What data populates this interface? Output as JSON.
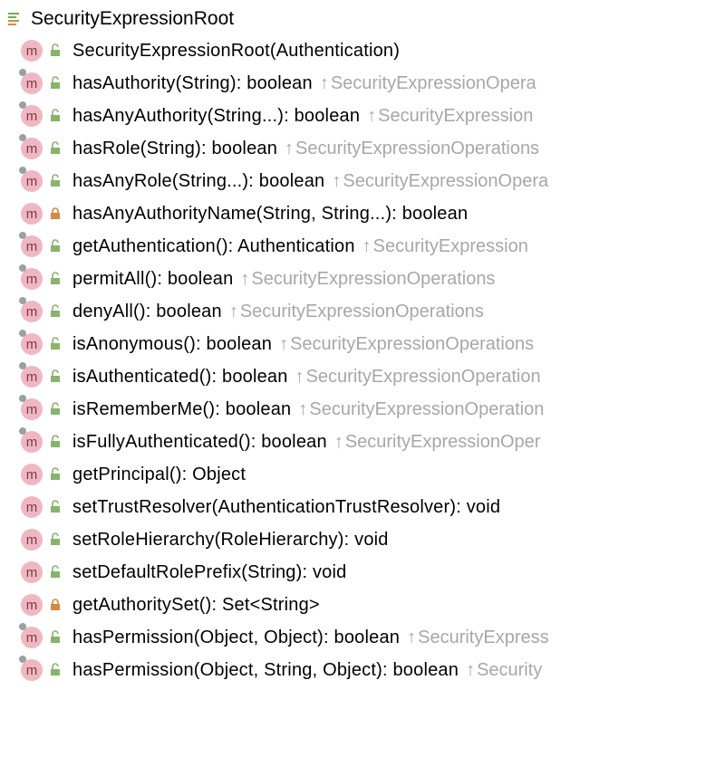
{
  "class_name": "SecurityExpressionRoot",
  "members": [
    {
      "signature": "SecurityExpressionRoot(Authentication)",
      "override": false,
      "visibility": "public",
      "inherited": ""
    },
    {
      "signature": "hasAuthority(String): boolean",
      "override": true,
      "visibility": "public",
      "inherited": "SecurityExpressionOpera"
    },
    {
      "signature": "hasAnyAuthority(String...): boolean",
      "override": true,
      "visibility": "public",
      "inherited": "SecurityExpression"
    },
    {
      "signature": "hasRole(String): boolean",
      "override": true,
      "visibility": "public",
      "inherited": "SecurityExpressionOperations"
    },
    {
      "signature": "hasAnyRole(String...): boolean",
      "override": true,
      "visibility": "public",
      "inherited": "SecurityExpressionOpera"
    },
    {
      "signature": "hasAnyAuthorityName(String, String...): boolean",
      "override": false,
      "visibility": "private",
      "inherited": ""
    },
    {
      "signature": "getAuthentication(): Authentication",
      "override": true,
      "visibility": "public",
      "inherited": "SecurityExpression"
    },
    {
      "signature": "permitAll(): boolean",
      "override": true,
      "visibility": "public",
      "inherited": "SecurityExpressionOperations"
    },
    {
      "signature": "denyAll(): boolean",
      "override": true,
      "visibility": "public",
      "inherited": "SecurityExpressionOperations"
    },
    {
      "signature": "isAnonymous(): boolean",
      "override": true,
      "visibility": "public",
      "inherited": "SecurityExpressionOperations"
    },
    {
      "signature": "isAuthenticated(): boolean",
      "override": true,
      "visibility": "public",
      "inherited": "SecurityExpressionOperation"
    },
    {
      "signature": "isRememberMe(): boolean",
      "override": true,
      "visibility": "public",
      "inherited": "SecurityExpressionOperation"
    },
    {
      "signature": "isFullyAuthenticated(): boolean",
      "override": true,
      "visibility": "public",
      "inherited": "SecurityExpressionOper"
    },
    {
      "signature": "getPrincipal(): Object",
      "override": false,
      "visibility": "public",
      "inherited": ""
    },
    {
      "signature": "setTrustResolver(AuthenticationTrustResolver): void",
      "override": false,
      "visibility": "public",
      "inherited": ""
    },
    {
      "signature": "setRoleHierarchy(RoleHierarchy): void",
      "override": false,
      "visibility": "public",
      "inherited": ""
    },
    {
      "signature": "setDefaultRolePrefix(String): void",
      "override": false,
      "visibility": "public",
      "inherited": ""
    },
    {
      "signature": "getAuthoritySet(): Set<String>",
      "override": false,
      "visibility": "private",
      "inherited": ""
    },
    {
      "signature": "hasPermission(Object, Object): boolean",
      "override": true,
      "visibility": "public",
      "inherited": "SecurityExpress"
    },
    {
      "signature": "hasPermission(Object, String, Object): boolean",
      "override": true,
      "visibility": "public",
      "inherited": "Security"
    }
  ]
}
